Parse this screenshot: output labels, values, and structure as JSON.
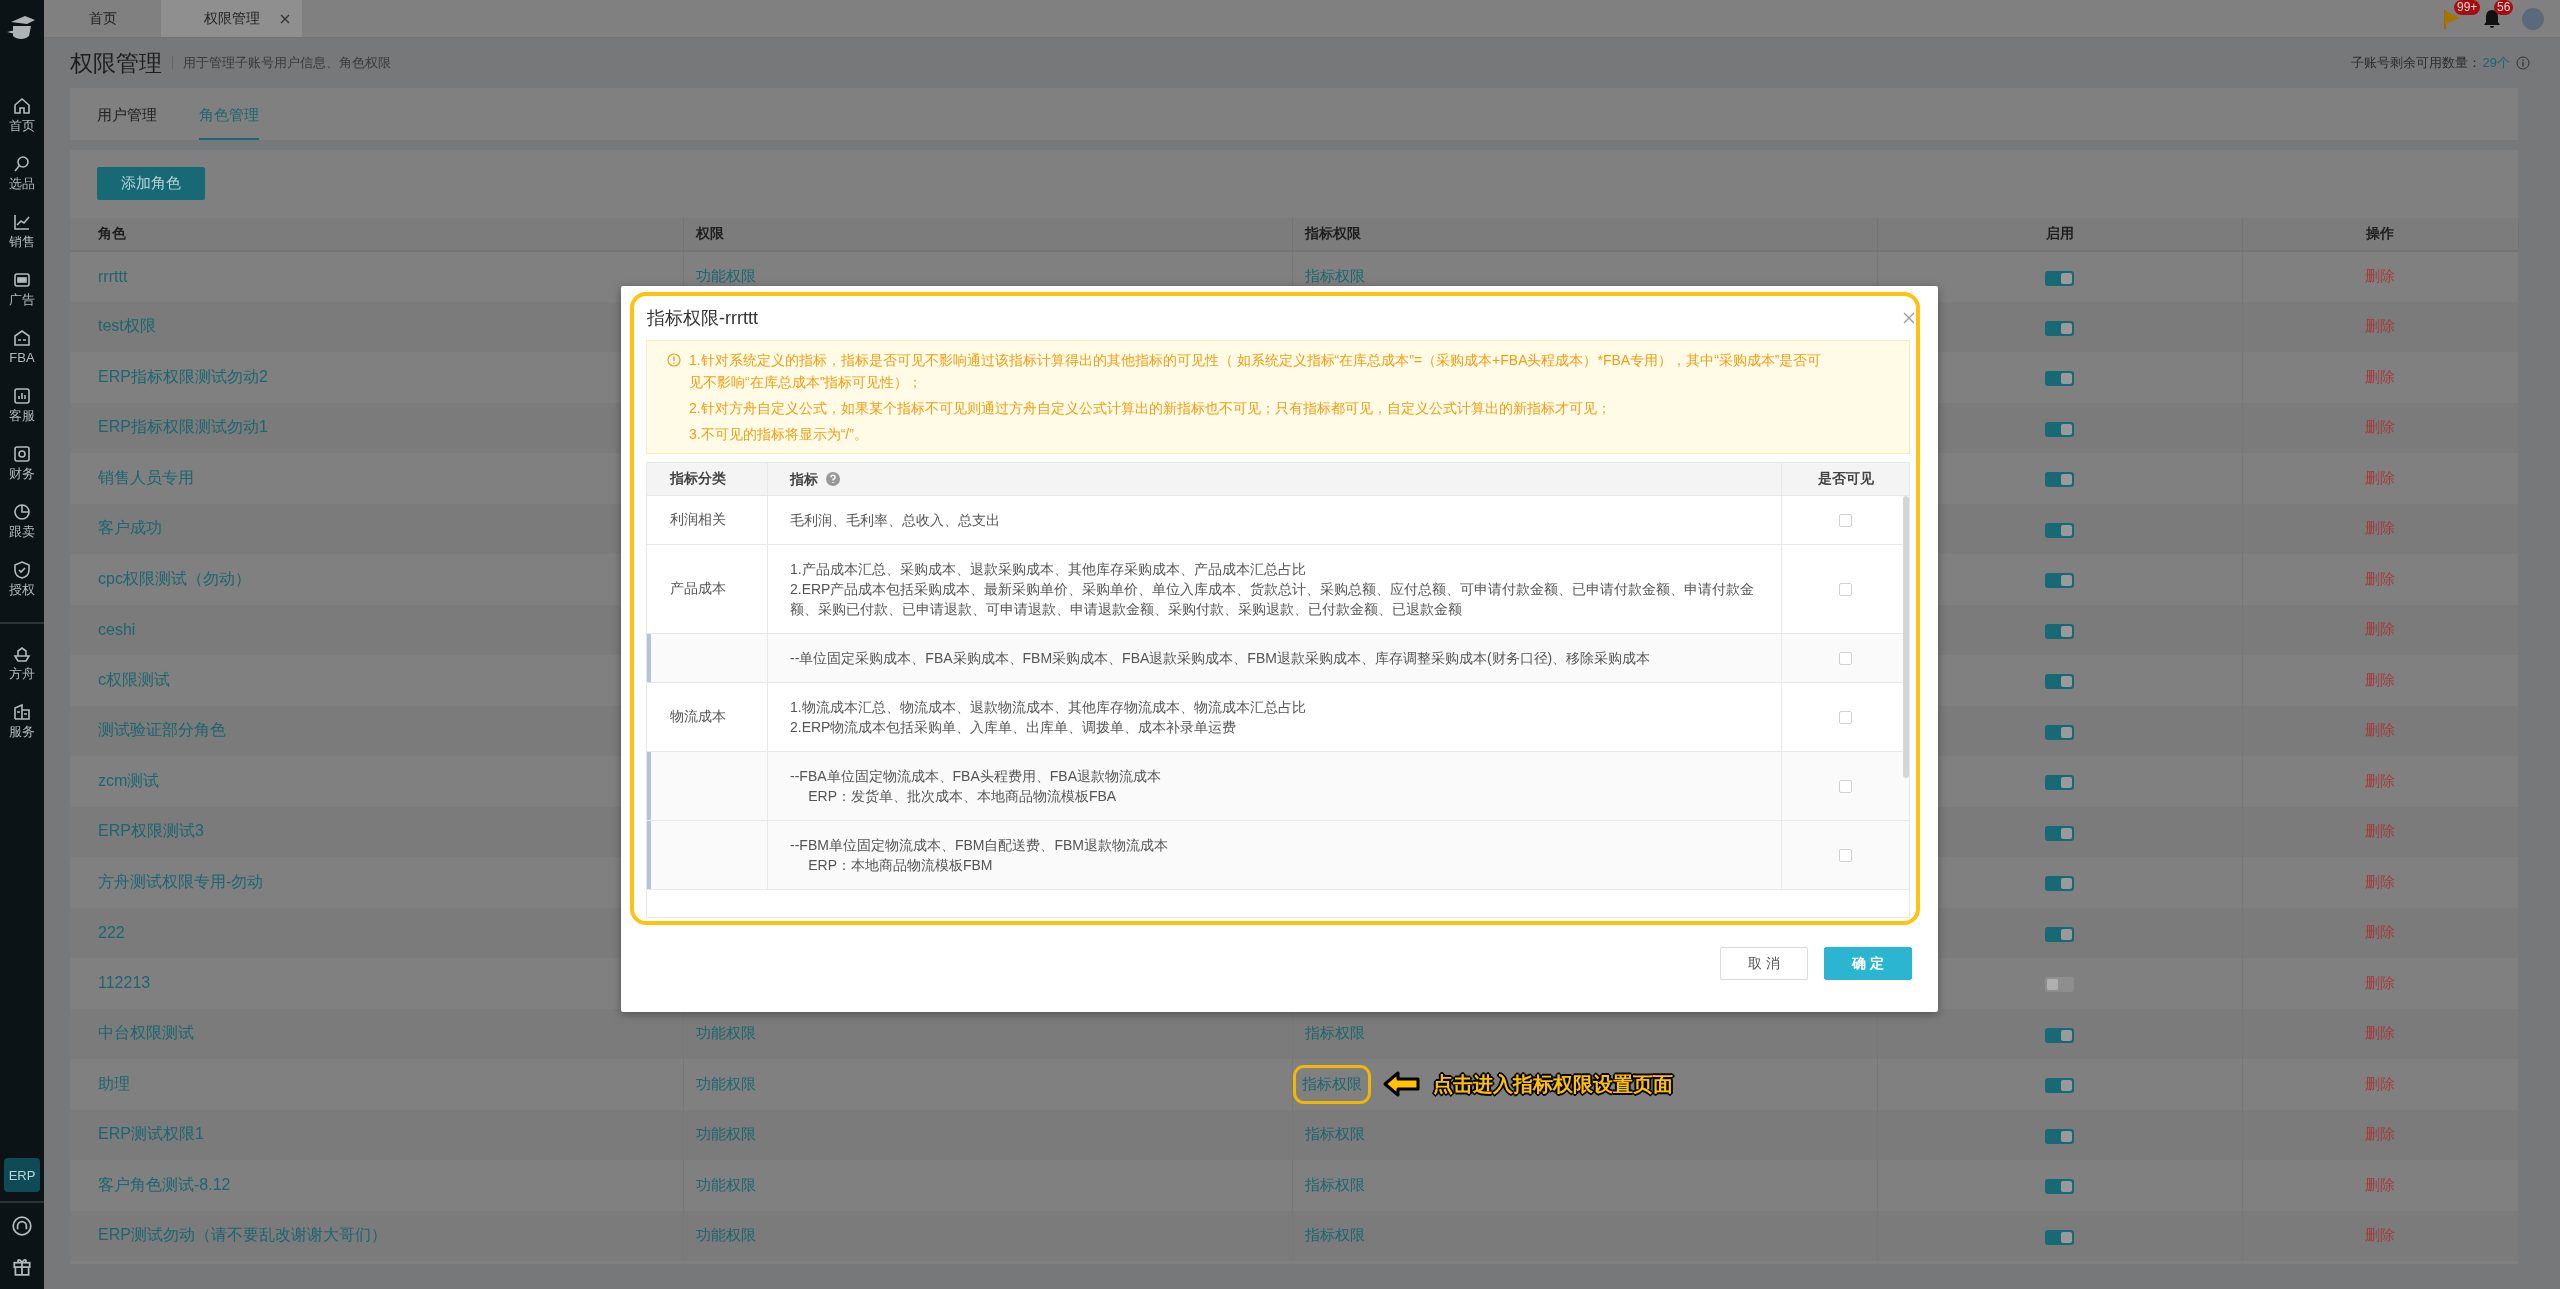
{
  "sidebar": {
    "items": [
      {
        "label": "首页"
      },
      {
        "label": "选品"
      },
      {
        "label": "销售"
      },
      {
        "label": "广告"
      },
      {
        "label": "FBA"
      },
      {
        "label": "客服"
      },
      {
        "label": "财务"
      },
      {
        "label": "跟卖"
      },
      {
        "label": "授权"
      },
      {
        "label": "方舟"
      },
      {
        "label": "服务"
      }
    ],
    "badge": "ERP"
  },
  "tabs": [
    {
      "label": "首页",
      "selected": false,
      "closable": false
    },
    {
      "label": "权限管理",
      "selected": true,
      "closable": true
    }
  ],
  "notifications": [
    {
      "count": "99+"
    },
    {
      "count": "56"
    }
  ],
  "page": {
    "title": "权限管理",
    "subtitle": "用于管理子账号用户信息、角色权限",
    "quota_label": "子账号剩余可用数量：",
    "quota_value": "29个"
  },
  "subtabs": [
    {
      "label": "用户管理",
      "selected": false
    },
    {
      "label": "角色管理",
      "selected": true
    }
  ],
  "add_button": "添加角色",
  "table": {
    "columns": [
      "角色",
      "权限",
      "指标权限",
      "启用",
      "操作"
    ],
    "rows": [
      {
        "role": "rrrttt",
        "permission": "功能权限",
        "metric": "指标权限",
        "enabled": true,
        "action": "删除"
      },
      {
        "role": "test权限",
        "enabled": true,
        "action": "删除"
      },
      {
        "role": "ERP指标权限测试勿动2",
        "enabled": true,
        "action": "删除"
      },
      {
        "role": "ERP指标权限测试勿动1",
        "enabled": true,
        "action": "删除"
      },
      {
        "role": "销售人员专用",
        "enabled": true,
        "action": "删除"
      },
      {
        "role": "客户成功",
        "enabled": true,
        "action": "删除"
      },
      {
        "role": "cpc权限测试（勿动）",
        "enabled": true,
        "action": "删除"
      },
      {
        "role": "ceshi",
        "enabled": true,
        "action": "删除"
      },
      {
        "role": "c权限测试",
        "enabled": true,
        "action": "删除"
      },
      {
        "role": "测试验证部分角色",
        "enabled": true,
        "action": "删除"
      },
      {
        "role": "zcm测试",
        "enabled": true,
        "action": "删除"
      },
      {
        "role": "ERP权限测试3",
        "enabled": true,
        "action": "删除"
      },
      {
        "role": "方舟测试权限专用-勿动",
        "enabled": true,
        "action": "删除"
      },
      {
        "role": "222",
        "enabled": true,
        "action": "删除"
      },
      {
        "role": "112213",
        "enabled": false,
        "action": "删除"
      },
      {
        "role": "中台权限测试",
        "permission": "功能权限",
        "metric": "指标权限",
        "enabled": true,
        "action": "删除"
      },
      {
        "role": "助理",
        "permission": "功能权限",
        "metric": "指标权限",
        "callout": "点击进入指标权限设置页面",
        "enabled": true,
        "action": "删除"
      },
      {
        "role": "ERP测试权限1",
        "permission": "功能权限",
        "metric": "指标权限",
        "enabled": true,
        "action": "删除"
      },
      {
        "role": "客户角色测试-8.12",
        "permission": "功能权限",
        "metric": "指标权限",
        "enabled": true,
        "action": "删除"
      },
      {
        "role": "ERP测试勿动（请不要乱改谢谢大哥们）",
        "permission": "功能权限",
        "metric": "指标权限",
        "enabled": true,
        "action": "删除"
      }
    ]
  },
  "dialog": {
    "title": "指标权限-rrrttt",
    "notice": [
      "1.针对系统定义的指标，指标是否可见不影响通过该指标计算得出的其他指标的可见性（ 如系统定义指标“在库总成本”=（采购成本+FBA头程成本）*FBA专用），其中“采购成本”是否可见不影响“在库总成本”指标可见性）；",
      "2.针对方舟自定义公式，如果某个指标不可见则通过方舟自定义公式计算出的新指标也不可见；只有指标都可见，自定义公式计算出的新指标才可见；",
      "3.不可见的指标将显示为“/”。"
    ],
    "columns": [
      "指标分类",
      "指标",
      "是否可见"
    ],
    "rows": [
      {
        "kind": "category",
        "category": "利润相关",
        "lines": [
          "毛利润、毛利率、总收入、总支出"
        ],
        "visible": false
      },
      {
        "kind": "category",
        "category": "产品成本",
        "lines": [
          "1.产品成本汇总、采购成本、退款采购成本、其他库存采购成本、产品成本汇总占比",
          "2.ERP产品成本包括采购成本、最新采购单价、采购单价、单位入库成本、货款总计、采购总额、应付总额、可申请付款金额、已申请付款金额、申请付款金额、采购已付款、已申请退款、可申请退款、申请退款金额、采购付款、采购退款、已付款金额、已退款金额"
        ],
        "visible": false
      },
      {
        "kind": "sub",
        "lines": [
          "--单位固定采购成本、FBA采购成本、FBM采购成本、FBA退款采购成本、FBM退款采购成本、库存调整采购成本(财务口径)、移除采购成本"
        ],
        "visible": false
      },
      {
        "kind": "category",
        "category": "物流成本",
        "lines": [
          "1.物流成本汇总、物流成本、退款物流成本、其他库存物流成本、物流成本汇总占比",
          "2.ERP物流成本包括采购单、入库单、出库单、调拨单、成本补录单运费"
        ],
        "visible": false
      },
      {
        "kind": "sub",
        "lines": [
          "--FBA单位固定物流成本、FBA头程费用、FBA退款物流成本",
          "ERP：发货单、批次成本、本地商品物流模板FBA"
        ],
        "visible": false
      },
      {
        "kind": "sub",
        "lines": [
          "--FBM单位固定物流成本、FBM自配送费、FBM退款物流成本",
          "ERP：本地商品物流模板FBM"
        ],
        "visible": false
      }
    ],
    "buttons": [
      {
        "label": "取 消",
        "kind": "secondary"
      },
      {
        "label": "确 定",
        "kind": "primary"
      }
    ]
  }
}
